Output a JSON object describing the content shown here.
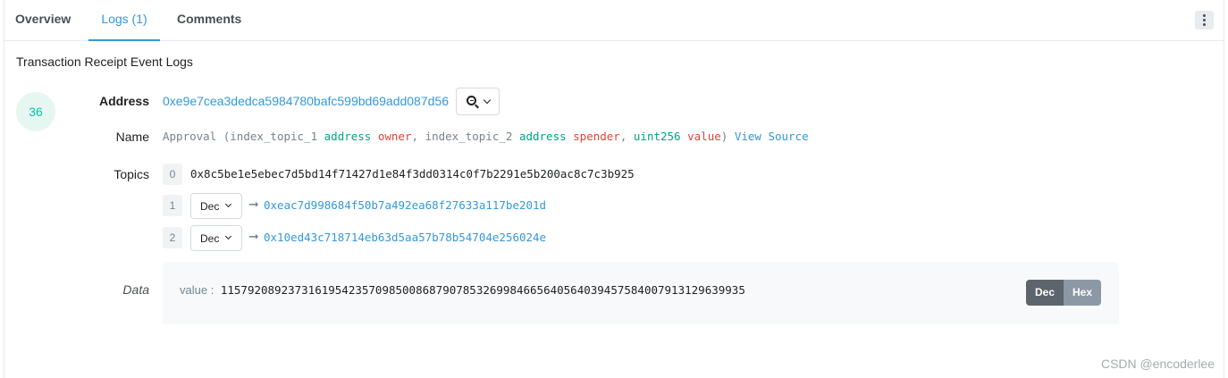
{
  "tabs": [
    {
      "label": "Overview"
    },
    {
      "label": "Logs (1)"
    },
    {
      "label": "Comments"
    }
  ],
  "subtitle": "Transaction Receipt Event Logs",
  "log": {
    "index": "36",
    "labels": {
      "address": "Address",
      "name": "Name",
      "topics": "Topics",
      "data": "Data"
    },
    "address": "0xe9e7cea3dedca5984780bafc599bd69add087d56",
    "name_parts": {
      "fn": "Approval (",
      "p1_name": "index_topic_1",
      "p1_type": "address",
      "p1_var": "owner",
      "sep1": ",",
      "p2_name": "index_topic_2",
      "p2_type": "address",
      "p2_var": "spender",
      "sep2": ",",
      "p3_type": "uint256",
      "p3_var": "value",
      "close": ")",
      "view_source": "View Source"
    },
    "topics": [
      {
        "index": "0",
        "value": "0x8c5be1e5ebec7d5bd14f71427d1e84f3dd0314c0f7b2291e5b200ac8c7c3b925"
      },
      {
        "index": "1",
        "format": "Dec",
        "value": "0xeac7d998684f50b7a492ea68f27633a117be201d"
      },
      {
        "index": "2",
        "format": "Dec",
        "value": "0x10ed43c718714eb63d5aa57b78b54704e256024e"
      }
    ],
    "data": {
      "key": "value :",
      "value": "115792089237316195423570985008687907853269984665640564039457584007913129639935",
      "toggle": {
        "dec": "Dec",
        "hex": "Hex"
      }
    }
  },
  "watermark": "CSDN @encoderlee",
  "colors": {
    "accent": "#3498db",
    "type": "#00a383",
    "var": "#de4437",
    "badge_bg": "#e6f7f2",
    "badge_fg": "#00c9a7"
  }
}
